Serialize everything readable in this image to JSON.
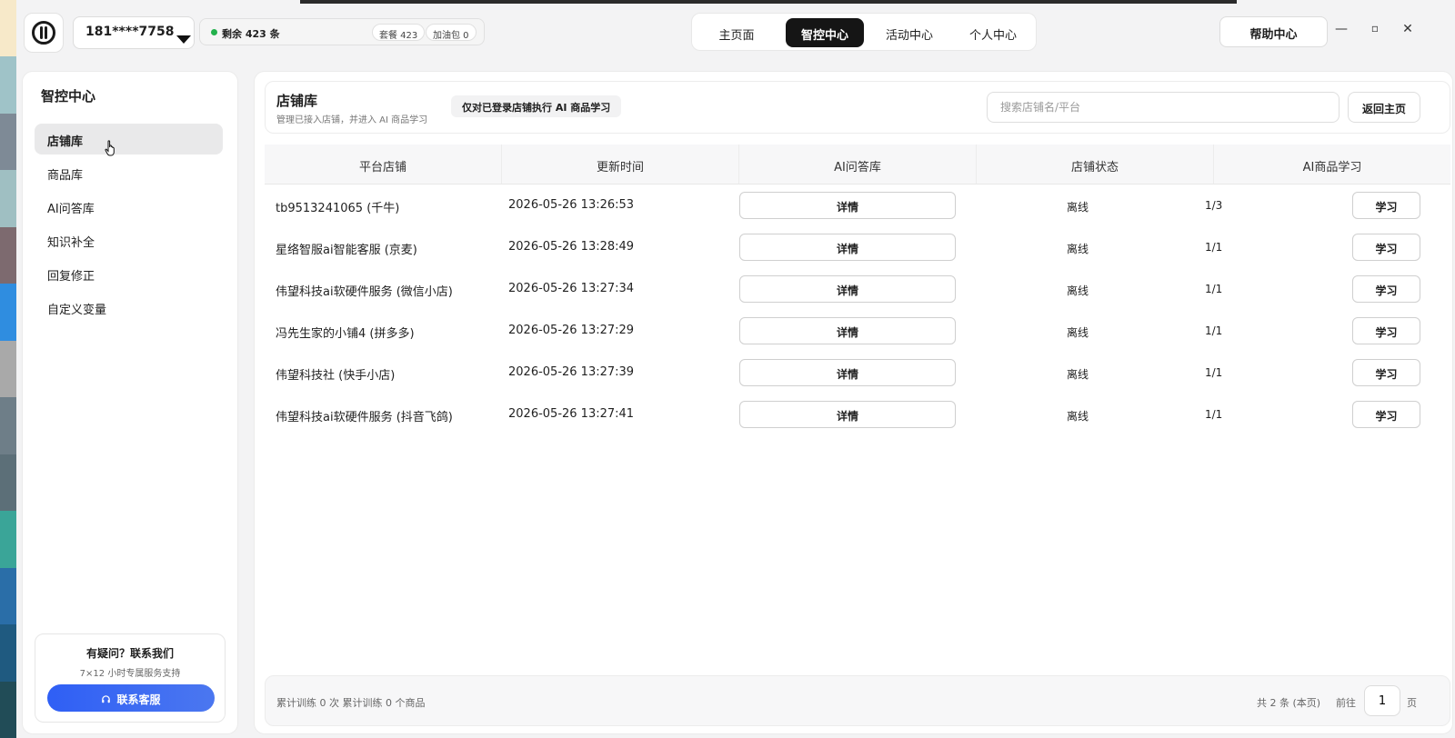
{
  "desktop_strip_colors": [
    "#f7e9c9",
    "#9fc3c8",
    "#7e8a96",
    "#9fbfc2",
    "#7d6a6f",
    "#2f8de0",
    "#a9a9a9",
    "#6e7e88",
    "#5c6f78",
    "#3aa598",
    "#2a6ea8",
    "#1f5a80",
    "#214c57"
  ],
  "header": {
    "logo": "brand-logo",
    "account": "181****7758",
    "quota_remaining": "剩余 423 条",
    "package_chip": "套餐 423",
    "addon_chip": "加油包 0",
    "status_color": "#22b14c",
    "nav_tabs": [
      "主页面",
      "智控中心",
      "活动中心",
      "个人中心"
    ],
    "active_tab": "智控中心",
    "help_label": "帮助中心",
    "win_min": "—",
    "win_max": "▫",
    "win_close": "✕"
  },
  "sidebar": {
    "title": "智控中心",
    "items": [
      "店铺库",
      "商品库",
      "AI问答库",
      "知识补全",
      "回复修正",
      "自定义变量"
    ],
    "active_item": "店铺库",
    "contact": {
      "title": "有疑问？联系我们",
      "subtitle": "7×12 小时专属服务支持",
      "button": "联系客服",
      "button_icon": "headset-icon",
      "button_color": "#2f5ff5"
    }
  },
  "main": {
    "title": "店铺库",
    "subtitle": "管理已接入店铺，并进入 AI 商品学习",
    "notice": "仅对已登录店铺执行 AI 商品学习",
    "search_placeholder": "搜索店铺名/平台",
    "back_label": "返回主页",
    "columns": [
      "平台店铺",
      "更新时间",
      "AI问答库",
      "店铺状态",
      "AI商品学习"
    ],
    "rows": [
      {
        "shop": "tb9513241065 (千牛)",
        "time": "2026-05-26 13:26:53",
        "detail": "详情",
        "status": "离线",
        "progress": "1/3",
        "learn": "学习"
      },
      {
        "shop": "星络智服ai智能客服 (京麦)",
        "time": "2026-05-26 13:28:49",
        "detail": "详情",
        "status": "离线",
        "progress": "1/1",
        "learn": "学习"
      },
      {
        "shop": "伟望科技ai软硬件服务 (微信小店)",
        "time": "2026-05-26 13:27:34",
        "detail": "详情",
        "status": "离线",
        "progress": "1/1",
        "learn": "学习"
      },
      {
        "shop": "冯先生家的小铺4 (拼多多)",
        "time": "2026-05-26 13:27:29",
        "detail": "详情",
        "status": "离线",
        "progress": "1/1",
        "learn": "学习"
      },
      {
        "shop": "伟望科技社 (快手小店)",
        "time": "2026-05-26 13:27:39",
        "detail": "详情",
        "status": "离线",
        "progress": "1/1",
        "learn": "学习"
      },
      {
        "shop": "伟望科技ai软硬件服务 (抖音飞鸽)",
        "time": "2026-05-26 13:27:41",
        "detail": "详情",
        "status": "离线",
        "progress": "1/1",
        "learn": "学习"
      }
    ],
    "footer": {
      "stats": "累计训练 0 次   累计训练 0 个商品",
      "total": "共 2 条 (本页)",
      "goto": "前往",
      "page": "1",
      "page_suffix": "页"
    }
  }
}
